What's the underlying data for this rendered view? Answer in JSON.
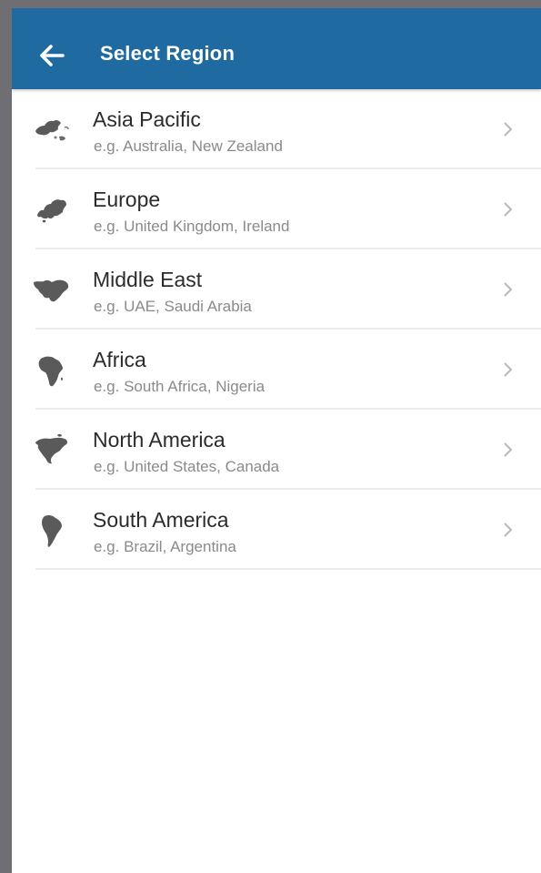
{
  "header": {
    "title": "Select Region",
    "back_icon": "arrow-left-icon",
    "background_color": "#1f6aa0"
  },
  "regions": [
    {
      "name": "Asia Pacific",
      "examples": "e.g. Australia, New Zealand",
      "icon": "asia-pacific-map-icon"
    },
    {
      "name": "Europe",
      "examples": "e.g. United Kingdom, Ireland",
      "icon": "europe-map-icon"
    },
    {
      "name": "Middle East",
      "examples": "e.g. UAE, Saudi Arabia",
      "icon": "middle-east-map-icon"
    },
    {
      "name": "Africa",
      "examples": "e.g. South Africa, Nigeria",
      "icon": "africa-map-icon"
    },
    {
      "name": "North America",
      "examples": "e.g. United States, Canada",
      "icon": "north-america-map-icon"
    },
    {
      "name": "South America",
      "examples": "e.g. Brazil, Argentina",
      "icon": "south-america-map-icon"
    }
  ],
  "row_chevron_icon": "chevron-right-icon"
}
